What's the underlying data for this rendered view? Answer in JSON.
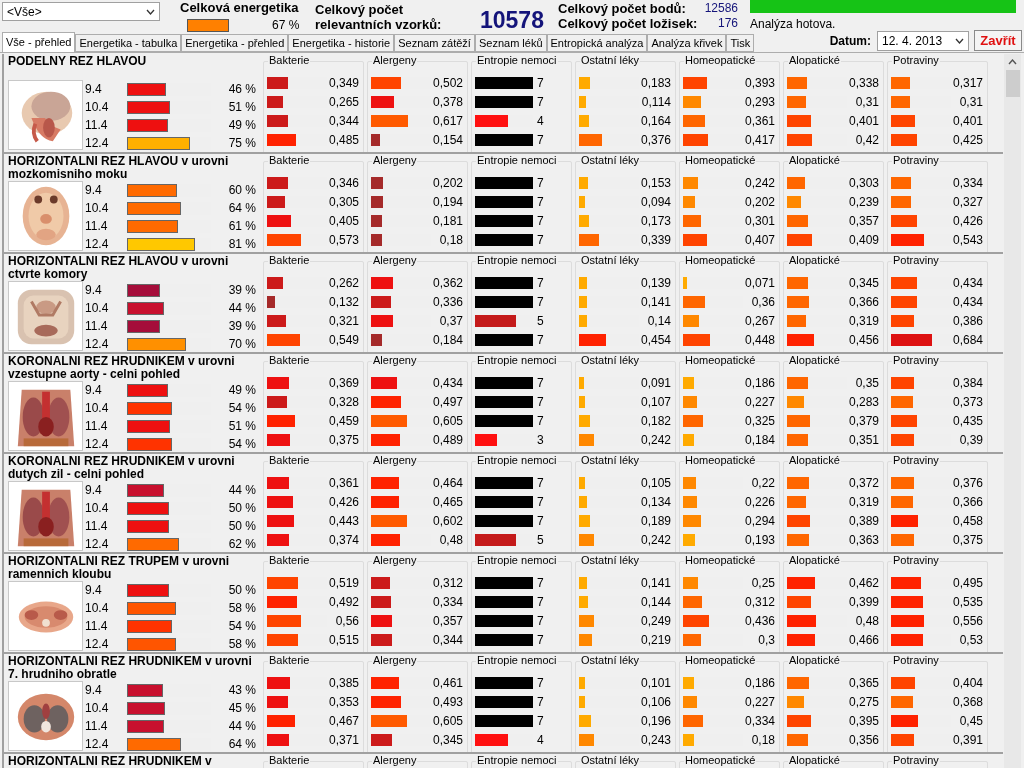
{
  "filter": {
    "value": "<Vše>"
  },
  "energy": {
    "label": "Celková energetika",
    "percent": "67 %",
    "level": 0.67
  },
  "samples": {
    "label_lines": [
      "Celkový počet",
      "relevantních vzorků:"
    ],
    "value": "10578"
  },
  "stats": [
    {
      "label": "Celkový počet bodů:",
      "value": "12586"
    },
    {
      "label": "Celkový počet ložisek:",
      "value": "176"
    }
  ],
  "progress": {
    "level": 1,
    "text": "Analýza hotova."
  },
  "tabs": [
    {
      "label": "Vše - přehled",
      "selected": true
    },
    {
      "label": "Energetika - tabulka",
      "selected": false
    },
    {
      "label": "Energetika - přehled",
      "selected": false
    },
    {
      "label": "Energetika - historie",
      "selected": false
    },
    {
      "label": "Seznam zátěží",
      "selected": false
    },
    {
      "label": "Seznam léků",
      "selected": false
    },
    {
      "label": "Entropická analýza",
      "selected": false
    },
    {
      "label": "Analýza křivek",
      "selected": false
    },
    {
      "label": "Tisk",
      "selected": false
    }
  ],
  "date": {
    "label": "Datum:",
    "value": "12. 4. 2013"
  },
  "close_button": "Zavřít",
  "sections": [
    {
      "title": "PODELNY REZ HLAVOU",
      "image": {
        "kind": "picture"
      },
      "rows": [
        {
          "date": "9.4",
          "percent": "46 %",
          "level": 0.46
        },
        {
          "date": "10.4",
          "percent": "51 %",
          "level": 0.51
        },
        {
          "date": "11.4",
          "percent": "49 %",
          "level": 0.49
        },
        {
          "date": "12.4",
          "percent": "75 %",
          "level": 0.75
        }
      ],
      "groups": [
        {
          "label": "Bakterie",
          "kind": "red",
          "items": [
            {
              "value": "0,349",
              "level": 0.349
            },
            {
              "value": "0,265",
              "level": 0.265
            },
            {
              "value": "0,344",
              "level": 0.344
            },
            {
              "value": "0,485",
              "level": 0.485
            }
          ]
        },
        {
          "label": "Alergeny",
          "kind": "red",
          "items": [
            {
              "value": "0,502",
              "level": 0.502
            },
            {
              "value": "0,378",
              "level": 0.378
            },
            {
              "value": "0,617",
              "level": 0.617
            },
            {
              "value": "0,154",
              "level": 0.154
            }
          ]
        },
        {
          "label": "Entropie nemoci",
          "kind": "count",
          "items": [
            {
              "value": "7",
              "level": 1
            },
            {
              "value": "7",
              "level": 1
            },
            {
              "value": "4",
              "level": 0.57
            },
            {
              "value": "7",
              "level": 1
            }
          ]
        },
        {
          "label": "Ostatní léky",
          "kind": "orange",
          "items": [
            {
              "value": "0,183",
              "level": 0.183
            },
            {
              "value": "0,114",
              "level": 0.114
            },
            {
              "value": "0,164",
              "level": 0.164
            },
            {
              "value": "0,376",
              "level": 0.376
            }
          ]
        },
        {
          "label": "Homeopatické",
          "kind": "orange",
          "items": [
            {
              "value": "0,393",
              "level": 0.393
            },
            {
              "value": "0,293",
              "level": 0.293
            },
            {
              "value": "0,361",
              "level": 0.361
            },
            {
              "value": "0,417",
              "level": 0.417
            }
          ]
        },
        {
          "label": "Alopatické",
          "kind": "orange",
          "items": [
            {
              "value": "0,338",
              "level": 0.338
            },
            {
              "value": "0,31",
              "level": 0.31
            },
            {
              "value": "0,401",
              "level": 0.401
            },
            {
              "value": "0,42",
              "level": 0.42
            }
          ]
        },
        {
          "label": "Potraviny",
          "kind": "orange",
          "items": [
            {
              "value": "0,317",
              "level": 0.317
            },
            {
              "value": "0,31",
              "level": 0.31
            },
            {
              "value": "0,401",
              "level": 0.401
            },
            {
              "value": "0,425",
              "level": 0.425
            }
          ]
        }
      ]
    },
    {
      "title": "HORIZONTALNI REZ HLAVOU v urovni mozkomisniho moku",
      "image": {
        "kind": "picture"
      },
      "rows": [
        {
          "date": "9.4",
          "percent": "60 %",
          "level": 0.6
        },
        {
          "date": "10.4",
          "percent": "64 %",
          "level": 0.64
        },
        {
          "date": "11.4",
          "percent": "61 %",
          "level": 0.61
        },
        {
          "date": "12.4",
          "percent": "81 %",
          "level": 0.81
        }
      ],
      "groups": [
        {
          "label": "Bakterie",
          "kind": "red",
          "items": [
            {
              "value": "0,346",
              "level": 0.346
            },
            {
              "value": "0,305",
              "level": 0.305
            },
            {
              "value": "0,405",
              "level": 0.405
            },
            {
              "value": "0,573",
              "level": 0.573
            }
          ]
        },
        {
          "label": "Alergeny",
          "kind": "red",
          "items": [
            {
              "value": "0,202",
              "level": 0.202
            },
            {
              "value": "0,194",
              "level": 0.194
            },
            {
              "value": "0,181",
              "level": 0.181
            },
            {
              "value": "0,18",
              "level": 0.18
            }
          ]
        },
        {
          "label": "Entropie nemoci",
          "kind": "count",
          "items": [
            {
              "value": "7",
              "level": 1
            },
            {
              "value": "7",
              "level": 1
            },
            {
              "value": "7",
              "level": 1
            },
            {
              "value": "7",
              "level": 1
            }
          ]
        },
        {
          "label": "Ostatní léky",
          "kind": "orange",
          "items": [
            {
              "value": "0,153",
              "level": 0.153
            },
            {
              "value": "0,094",
              "level": 0.094
            },
            {
              "value": "0,173",
              "level": 0.173
            },
            {
              "value": "0,339",
              "level": 0.339
            }
          ]
        },
        {
          "label": "Homeopatické",
          "kind": "orange",
          "items": [
            {
              "value": "0,242",
              "level": 0.242
            },
            {
              "value": "0,202",
              "level": 0.202
            },
            {
              "value": "0,301",
              "level": 0.301
            },
            {
              "value": "0,407",
              "level": 0.407
            }
          ]
        },
        {
          "label": "Alopatické",
          "kind": "orange",
          "items": [
            {
              "value": "0,303",
              "level": 0.303
            },
            {
              "value": "0,239",
              "level": 0.239
            },
            {
              "value": "0,357",
              "level": 0.357
            },
            {
              "value": "0,409",
              "level": 0.409
            }
          ]
        },
        {
          "label": "Potraviny",
          "kind": "orange",
          "items": [
            {
              "value": "0,334",
              "level": 0.334
            },
            {
              "value": "0,327",
              "level": 0.327
            },
            {
              "value": "0,426",
              "level": 0.426
            },
            {
              "value": "0,543",
              "level": 0.543
            }
          ]
        }
      ]
    },
    {
      "title": "HORIZONTALNI REZ HLAVOU v urovni ctvrte komory",
      "image": {
        "kind": "picture"
      },
      "rows": [
        {
          "date": "9.4",
          "percent": "39 %",
          "level": 0.39
        },
        {
          "date": "10.4",
          "percent": "44 %",
          "level": 0.44
        },
        {
          "date": "11.4",
          "percent": "39 %",
          "level": 0.39
        },
        {
          "date": "12.4",
          "percent": "70 %",
          "level": 0.7
        }
      ],
      "groups": [
        {
          "label": "Bakterie",
          "kind": "red",
          "items": [
            {
              "value": "0,262",
              "level": 0.262
            },
            {
              "value": "0,132",
              "level": 0.132
            },
            {
              "value": "0,321",
              "level": 0.321
            },
            {
              "value": "0,549",
              "level": 0.549
            }
          ]
        },
        {
          "label": "Alergeny",
          "kind": "red",
          "items": [
            {
              "value": "0,362",
              "level": 0.362
            },
            {
              "value": "0,336",
              "level": 0.336
            },
            {
              "value": "0,37",
              "level": 0.37
            },
            {
              "value": "0,184",
              "level": 0.184
            }
          ]
        },
        {
          "label": "Entropie nemoci",
          "kind": "count",
          "items": [
            {
              "value": "7",
              "level": 1
            },
            {
              "value": "7",
              "level": 1
            },
            {
              "value": "5",
              "level": 0.71
            },
            {
              "value": "7",
              "level": 1
            }
          ]
        },
        {
          "label": "Ostatní léky",
          "kind": "orange",
          "items": [
            {
              "value": "0,139",
              "level": 0.139
            },
            {
              "value": "0,141",
              "level": 0.141
            },
            {
              "value": "0,14",
              "level": 0.14
            },
            {
              "value": "0,454",
              "level": 0.454
            }
          ]
        },
        {
          "label": "Homeopatické",
          "kind": "orange",
          "items": [
            {
              "value": "0,071",
              "level": 0.071
            },
            {
              "value": "0,36",
              "level": 0.36
            },
            {
              "value": "0,267",
              "level": 0.267
            },
            {
              "value": "0,448",
              "level": 0.448
            }
          ]
        },
        {
          "label": "Alopatické",
          "kind": "orange",
          "items": [
            {
              "value": "0,345",
              "level": 0.345
            },
            {
              "value": "0,366",
              "level": 0.366
            },
            {
              "value": "0,319",
              "level": 0.319
            },
            {
              "value": "0,456",
              "level": 0.456
            }
          ]
        },
        {
          "label": "Potraviny",
          "kind": "orange",
          "items": [
            {
              "value": "0,434",
              "level": 0.434
            },
            {
              "value": "0,434",
              "level": 0.434
            },
            {
              "value": "0,386",
              "level": 0.386
            },
            {
              "value": "0,684",
              "level": 0.684
            }
          ]
        }
      ]
    },
    {
      "title": "KORONALNI REZ HRUDNIKEM v urovni vzestupne aorty - celni pohled",
      "image": {
        "kind": "picture"
      },
      "rows": [
        {
          "date": "9.4",
          "percent": "49 %",
          "level": 0.49
        },
        {
          "date": "10.4",
          "percent": "54 %",
          "level": 0.54
        },
        {
          "date": "11.4",
          "percent": "51 %",
          "level": 0.51
        },
        {
          "date": "12.4",
          "percent": "54 %",
          "level": 0.54
        }
      ],
      "groups": [
        {
          "label": "Bakterie",
          "kind": "red",
          "items": [
            {
              "value": "0,369",
              "level": 0.369
            },
            {
              "value": "0,328",
              "level": 0.328
            },
            {
              "value": "0,459",
              "level": 0.459
            },
            {
              "value": "0,375",
              "level": 0.375
            }
          ]
        },
        {
          "label": "Alergeny",
          "kind": "red",
          "items": [
            {
              "value": "0,434",
              "level": 0.434
            },
            {
              "value": "0,497",
              "level": 0.497
            },
            {
              "value": "0,605",
              "level": 0.605
            },
            {
              "value": "0,489",
              "level": 0.489
            }
          ]
        },
        {
          "label": "Entropie nemoci",
          "kind": "count",
          "items": [
            {
              "value": "7",
              "level": 1
            },
            {
              "value": "7",
              "level": 1
            },
            {
              "value": "7",
              "level": 1
            },
            {
              "value": "3",
              "level": 0.38
            }
          ]
        },
        {
          "label": "Ostatní léky",
          "kind": "orange",
          "items": [
            {
              "value": "0,091",
              "level": 0.091
            },
            {
              "value": "0,107",
              "level": 0.107
            },
            {
              "value": "0,182",
              "level": 0.182
            },
            {
              "value": "0,242",
              "level": 0.242
            }
          ]
        },
        {
          "label": "Homeopatické",
          "kind": "orange",
          "items": [
            {
              "value": "0,186",
              "level": 0.186
            },
            {
              "value": "0,227",
              "level": 0.227
            },
            {
              "value": "0,325",
              "level": 0.325
            },
            {
              "value": "0,184",
              "level": 0.184
            }
          ]
        },
        {
          "label": "Alopatické",
          "kind": "orange",
          "items": [
            {
              "value": "0,35",
              "level": 0.35
            },
            {
              "value": "0,283",
              "level": 0.283
            },
            {
              "value": "0,379",
              "level": 0.379
            },
            {
              "value": "0,351",
              "level": 0.351
            }
          ]
        },
        {
          "label": "Potraviny",
          "kind": "orange",
          "items": [
            {
              "value": "0,384",
              "level": 0.384
            },
            {
              "value": "0,373",
              "level": 0.373
            },
            {
              "value": "0,435",
              "level": 0.435
            },
            {
              "value": "0,39",
              "level": 0.39
            }
          ]
        }
      ]
    },
    {
      "title": "KORONALNI REZ HRUDNIKEM v urovni dutych zil - celni pohled",
      "image": {
        "kind": "picture"
      },
      "rows": [
        {
          "date": "9.4",
          "percent": "44 %",
          "level": 0.44
        },
        {
          "date": "10.4",
          "percent": "50 %",
          "level": 0.5
        },
        {
          "date": "11.4",
          "percent": "50 %",
          "level": 0.5
        },
        {
          "date": "12.4",
          "percent": "62 %",
          "level": 0.62
        }
      ],
      "groups": [
        {
          "label": "Bakterie",
          "kind": "red",
          "items": [
            {
              "value": "0,361",
              "level": 0.361
            },
            {
              "value": "0,426",
              "level": 0.426
            },
            {
              "value": "0,443",
              "level": 0.443
            },
            {
              "value": "0,374",
              "level": 0.374
            }
          ]
        },
        {
          "label": "Alergeny",
          "kind": "red",
          "items": [
            {
              "value": "0,464",
              "level": 0.464
            },
            {
              "value": "0,465",
              "level": 0.465
            },
            {
              "value": "0,602",
              "level": 0.602
            },
            {
              "value": "0,48",
              "level": 0.48
            }
          ]
        },
        {
          "label": "Entropie nemoci",
          "kind": "count",
          "items": [
            {
              "value": "7",
              "level": 1
            },
            {
              "value": "7",
              "level": 1
            },
            {
              "value": "7",
              "level": 1
            },
            {
              "value": "5",
              "level": 0.71
            }
          ]
        },
        {
          "label": "Ostatní léky",
          "kind": "orange",
          "items": [
            {
              "value": "0,105",
              "level": 0.105
            },
            {
              "value": "0,134",
              "level": 0.134
            },
            {
              "value": "0,189",
              "level": 0.189
            },
            {
              "value": "0,242",
              "level": 0.242
            }
          ]
        },
        {
          "label": "Homeopatické",
          "kind": "orange",
          "items": [
            {
              "value": "0,22",
              "level": 0.22
            },
            {
              "value": "0,226",
              "level": 0.226
            },
            {
              "value": "0,294",
              "level": 0.294
            },
            {
              "value": "0,193",
              "level": 0.193
            }
          ]
        },
        {
          "label": "Alopatické",
          "kind": "orange",
          "items": [
            {
              "value": "0,372",
              "level": 0.372
            },
            {
              "value": "0,319",
              "level": 0.319
            },
            {
              "value": "0,389",
              "level": 0.389
            },
            {
              "value": "0,363",
              "level": 0.363
            }
          ]
        },
        {
          "label": "Potraviny",
          "kind": "orange",
          "items": [
            {
              "value": "0,376",
              "level": 0.376
            },
            {
              "value": "0,366",
              "level": 0.366
            },
            {
              "value": "0,458",
              "level": 0.458
            },
            {
              "value": "0,375",
              "level": 0.375
            }
          ]
        }
      ]
    },
    {
      "title": "HORIZONTALNI REZ TRUPEM v urovni ramennich kloubu",
      "image": {
        "kind": "picture"
      },
      "rows": [
        {
          "date": "9.4",
          "percent": "50 %",
          "level": 0.5
        },
        {
          "date": "10.4",
          "percent": "58 %",
          "level": 0.58
        },
        {
          "date": "11.4",
          "percent": "54 %",
          "level": 0.54
        },
        {
          "date": "12.4",
          "percent": "58 %",
          "level": 0.58
        }
      ],
      "groups": [
        {
          "label": "Bakterie",
          "kind": "red",
          "items": [
            {
              "value": "0,519",
              "level": 0.519
            },
            {
              "value": "0,492",
              "level": 0.492
            },
            {
              "value": "0,56",
              "level": 0.56
            },
            {
              "value": "0,515",
              "level": 0.515
            }
          ]
        },
        {
          "label": "Alergeny",
          "kind": "red",
          "items": [
            {
              "value": "0,312",
              "level": 0.312
            },
            {
              "value": "0,334",
              "level": 0.334
            },
            {
              "value": "0,357",
              "level": 0.357
            },
            {
              "value": "0,344",
              "level": 0.344
            }
          ]
        },
        {
          "label": "Entropie nemoci",
          "kind": "count",
          "items": [
            {
              "value": "7",
              "level": 1
            },
            {
              "value": "7",
              "level": 1
            },
            {
              "value": "7",
              "level": 1
            },
            {
              "value": "7",
              "level": 1
            }
          ]
        },
        {
          "label": "Ostatní léky",
          "kind": "orange",
          "items": [
            {
              "value": "0,141",
              "level": 0.141
            },
            {
              "value": "0,144",
              "level": 0.144
            },
            {
              "value": "0,249",
              "level": 0.249
            },
            {
              "value": "0,219",
              "level": 0.219
            }
          ]
        },
        {
          "label": "Homeopatické",
          "kind": "orange",
          "items": [
            {
              "value": "0,25",
              "level": 0.25
            },
            {
              "value": "0,312",
              "level": 0.312
            },
            {
              "value": "0,436",
              "level": 0.436
            },
            {
              "value": "0,3",
              "level": 0.3
            }
          ]
        },
        {
          "label": "Alopatické",
          "kind": "orange",
          "items": [
            {
              "value": "0,462",
              "level": 0.462
            },
            {
              "value": "0,399",
              "level": 0.399
            },
            {
              "value": "0,48",
              "level": 0.48
            },
            {
              "value": "0,466",
              "level": 0.466
            }
          ]
        },
        {
          "label": "Potraviny",
          "kind": "orange",
          "items": [
            {
              "value": "0,495",
              "level": 0.495
            },
            {
              "value": "0,535",
              "level": 0.535
            },
            {
              "value": "0,556",
              "level": 0.556
            },
            {
              "value": "0,53",
              "level": 0.53
            }
          ]
        }
      ]
    },
    {
      "title": "HORIZONTALNI REZ HRUDNIKEM v urovni 7. hrudniho obratle",
      "image": {
        "kind": "picture"
      },
      "rows": [
        {
          "date": "9.4",
          "percent": "43 %",
          "level": 0.43
        },
        {
          "date": "10.4",
          "percent": "45 %",
          "level": 0.45
        },
        {
          "date": "11.4",
          "percent": "44 %",
          "level": 0.44
        },
        {
          "date": "12.4",
          "percent": "64 %",
          "level": 0.64
        }
      ],
      "groups": [
        {
          "label": "Bakterie",
          "kind": "red",
          "items": [
            {
              "value": "0,385",
              "level": 0.385
            },
            {
              "value": "0,353",
              "level": 0.353
            },
            {
              "value": "0,467",
              "level": 0.467
            },
            {
              "value": "0,371",
              "level": 0.371
            }
          ]
        },
        {
          "label": "Alergeny",
          "kind": "red",
          "items": [
            {
              "value": "0,461",
              "level": 0.461
            },
            {
              "value": "0,493",
              "level": 0.493
            },
            {
              "value": "0,605",
              "level": 0.605
            },
            {
              "value": "0,345",
              "level": 0.345
            }
          ]
        },
        {
          "label": "Entropie nemoci",
          "kind": "count",
          "items": [
            {
              "value": "7",
              "level": 1
            },
            {
              "value": "7",
              "level": 1
            },
            {
              "value": "7",
              "level": 1
            },
            {
              "value": "4",
              "level": 0.57
            }
          ]
        },
        {
          "label": "Ostatní léky",
          "kind": "orange",
          "items": [
            {
              "value": "0,101",
              "level": 0.101
            },
            {
              "value": "0,106",
              "level": 0.106
            },
            {
              "value": "0,196",
              "level": 0.196
            },
            {
              "value": "0,243",
              "level": 0.243
            }
          ]
        },
        {
          "label": "Homeopatické",
          "kind": "orange",
          "items": [
            {
              "value": "0,186",
              "level": 0.186
            },
            {
              "value": "0,227",
              "level": 0.227
            },
            {
              "value": "0,334",
              "level": 0.334
            },
            {
              "value": "0,18",
              "level": 0.18
            }
          ]
        },
        {
          "label": "Alopatické",
          "kind": "orange",
          "items": [
            {
              "value": "0,365",
              "level": 0.365
            },
            {
              "value": "0,275",
              "level": 0.275
            },
            {
              "value": "0,395",
              "level": 0.395
            },
            {
              "value": "0,356",
              "level": 0.356
            }
          ]
        },
        {
          "label": "Potraviny",
          "kind": "orange",
          "items": [
            {
              "value": "0,404",
              "level": 0.404
            },
            {
              "value": "0,368",
              "level": 0.368
            },
            {
              "value": "0,45",
              "level": 0.45
            },
            {
              "value": "0,391",
              "level": 0.391
            }
          ]
        }
      ]
    },
    {
      "title": "HORIZONTALNI REZ HRUDNIKEM v",
      "groups": [
        {
          "label": "Bakterie"
        },
        {
          "label": "Alergeny"
        },
        {
          "label": "Entropie nemoci"
        },
        {
          "label": "Ostatní léky"
        },
        {
          "label": "Homeopatické"
        },
        {
          "label": "Alopatické"
        },
        {
          "label": "Potraviny"
        }
      ]
    }
  ]
}
